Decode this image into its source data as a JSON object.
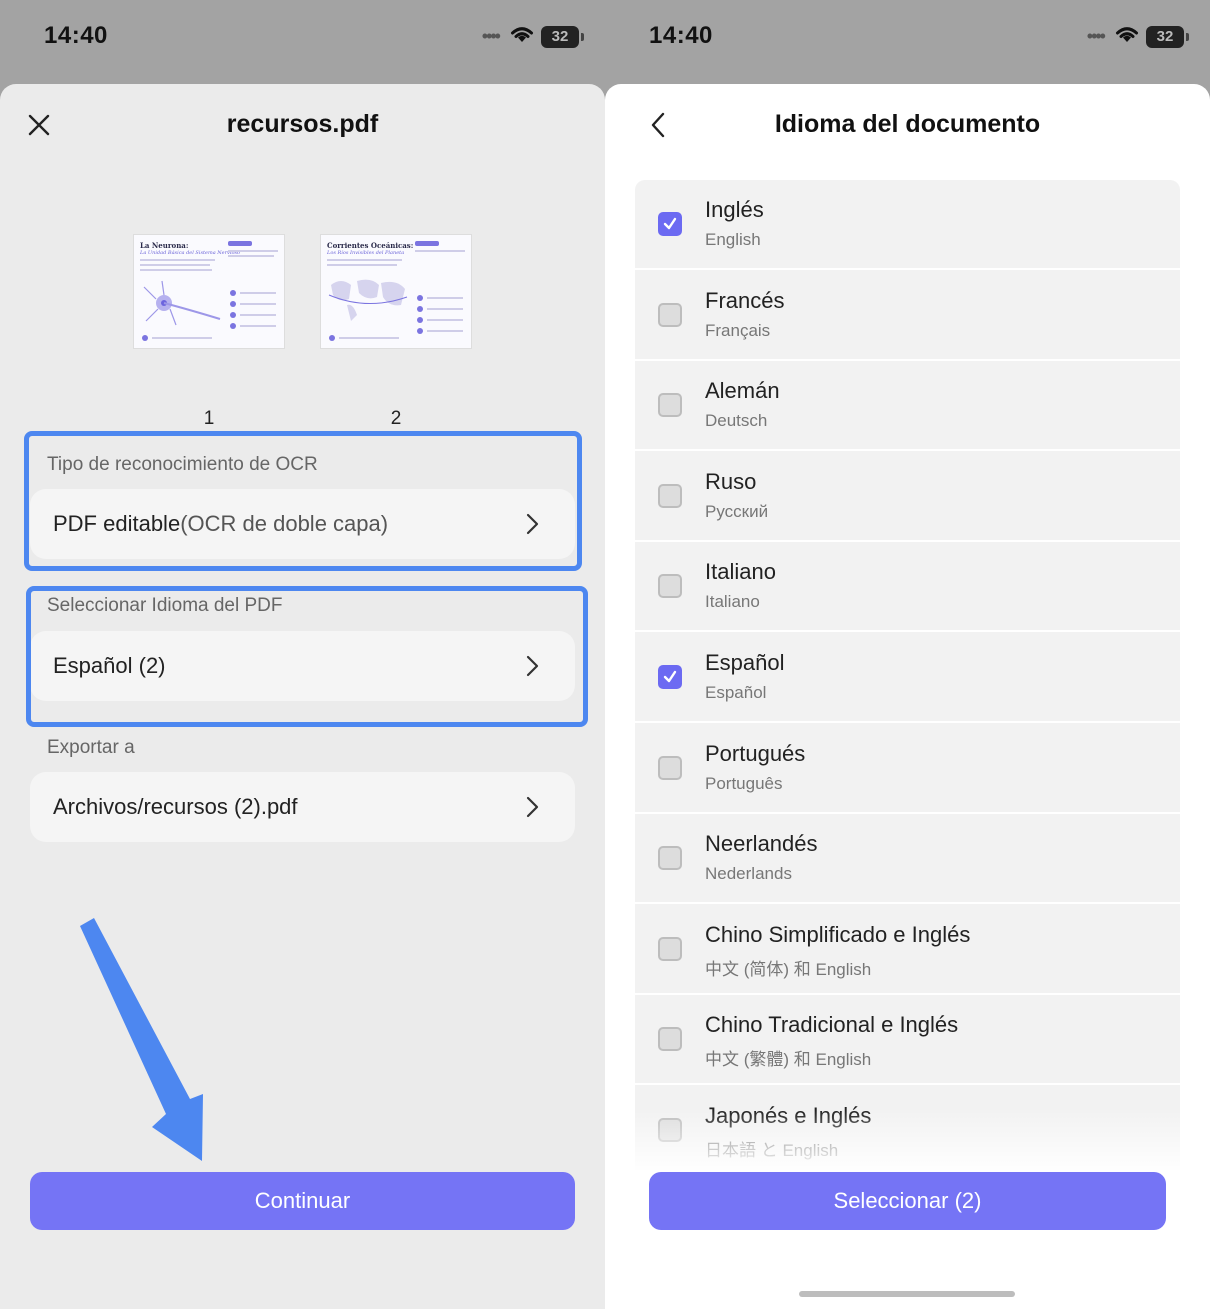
{
  "status": {
    "time": "14:40",
    "battery": "32"
  },
  "left": {
    "title": "recursos.pdf",
    "page_numbers": [
      "1",
      "2"
    ],
    "thumbs": [
      {
        "title": "La Neurona:",
        "subtitle": "La Unidad Básica del Sistema Nervioso"
      },
      {
        "title": "Corrientes Oceánicas:",
        "subtitle": "Los Ríos Invisibles del Planeta"
      }
    ],
    "ocr_section_label": "Tipo de reconocimiento de OCR",
    "ocr_value_main": "PDF editable",
    "ocr_value_detail": "(OCR de doble capa)",
    "language_section_label": "Seleccionar Idioma del PDF",
    "language_value": "Español (2)",
    "export_section_label": "Exportar a",
    "export_value": "Archivos/recursos (2).pdf",
    "continue_label": "Continuar",
    "arrow_color": "#4d87f0"
  },
  "right": {
    "title": "Idioma del documento",
    "languages": [
      {
        "name": "Inglés",
        "native": "English",
        "checked": true
      },
      {
        "name": "Francés",
        "native": "Français",
        "checked": false
      },
      {
        "name": "Alemán",
        "native": "Deutsch",
        "checked": false
      },
      {
        "name": "Ruso",
        "native": "Русский",
        "checked": false
      },
      {
        "name": "Italiano",
        "native": "Italiano",
        "checked": false
      },
      {
        "name": "Español",
        "native": "Español",
        "checked": true
      },
      {
        "name": "Portugués",
        "native": "Português",
        "checked": false
      },
      {
        "name": "Neerlandés",
        "native": "Nederlands",
        "checked": false
      },
      {
        "name": "Chino Simplificado e Inglés",
        "native": "中文 (简体) 和 English",
        "checked": false
      },
      {
        "name": "Chino Tradicional e Inglés",
        "native": "中文 (繁體) 和 English",
        "checked": false
      },
      {
        "name": "Japonés e Inglés",
        "native": "日本語 と English",
        "checked": false
      }
    ],
    "select_label": "Seleccionar (2)"
  },
  "colors": {
    "accent": "#7574f5",
    "highlight": "#4d87f0",
    "checkbox_checked": "#6c6af2"
  }
}
